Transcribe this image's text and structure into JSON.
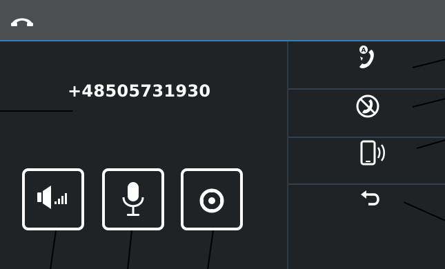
{
  "call": {
    "number": "+48505731930"
  },
  "icons": {
    "hangup": "hangup-icon",
    "auto_answer": "auto-answer-icon",
    "call_block": "call-block-icon",
    "vibrate": "vibrate-icon",
    "back": "back-icon",
    "speaker": "speaker-icon",
    "microphone": "microphone-icon",
    "keypad": "keypad-icon"
  },
  "colors": {
    "background": "#1f2326",
    "topbar": "#4b4f52",
    "accent": "#2f7fb8",
    "icon": "#ffffff"
  }
}
